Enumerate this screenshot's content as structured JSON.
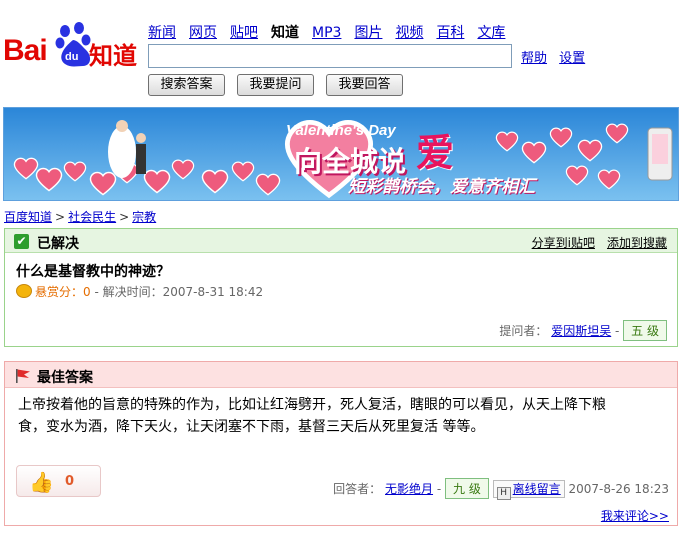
{
  "logo": {
    "bai": "Bai",
    "du": "du",
    "zhidao": "知道"
  },
  "nav": [
    {
      "label": "新闻",
      "current": false
    },
    {
      "label": "网页",
      "current": false
    },
    {
      "label": "贴吧",
      "current": false
    },
    {
      "label": "知道",
      "current": true
    },
    {
      "label": "MP3",
      "current": false
    },
    {
      "label": "图片",
      "current": false
    },
    {
      "label": "视频",
      "current": false
    },
    {
      "label": "百科",
      "current": false
    },
    {
      "label": "文库",
      "current": false
    }
  ],
  "search": {
    "value": "",
    "help": "帮助",
    "settings": "设置"
  },
  "buttons": {
    "search_answer": "搜索答案",
    "ask": "我要提问",
    "answer": "我要回答"
  },
  "banner": {
    "title_en": "Valentine's Day",
    "headline": "向全城说",
    "ai": "爱",
    "sub": "短彩鹊桥会，爱意齐相汇"
  },
  "breadcrumb": {
    "home": "百度知道",
    "cat1": "社会民生",
    "cat2": "宗教",
    "sep": ">"
  },
  "question": {
    "status": "已解决",
    "share": "分享到i贴吧",
    "favorite": "添加到搜藏",
    "text": "什么是基督教中的神迹？",
    "reward_label": "悬赏分：0",
    "resolved_time": "- 解决时间：2007-8-31 18:42",
    "asker_label": "提问者：",
    "asker": "爱因斯坦吴",
    "asker_grade": "五 级"
  },
  "answer": {
    "title": "最佳答案",
    "text": "上帝按着他的旨意的特殊的作为，比如让红海劈开，死人复活，瞎眼的可以看见，从天上降下粮食，变水为酒，降下天火，让天闭塞不下雨，基督三天后从死里复活 等等。",
    "votes": "0",
    "answerer_label": "回答者：",
    "answerer": "无影绝月",
    "answerer_grade": "九 级",
    "offline_msg": "离线留言",
    "time": "2007-8-26 18:23",
    "comment_link": "我来评论>>"
  },
  "colors": {
    "brand_red": "#e10602",
    "link": "#0000cc",
    "solved_bg": "#e6f5e1",
    "best_bg": "#fde1e1"
  }
}
